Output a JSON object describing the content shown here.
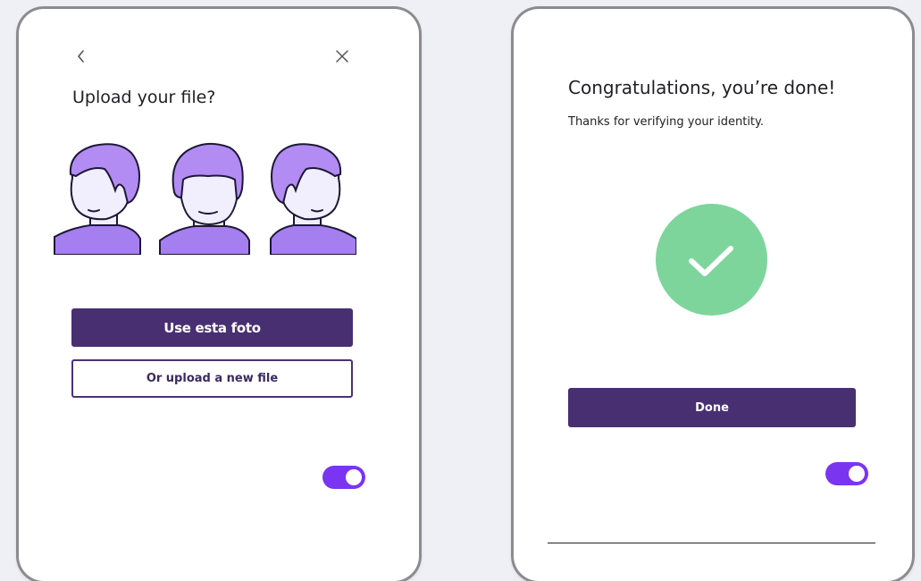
{
  "upload_screen": {
    "back_icon": "chevron-left-icon",
    "close_icon": "close-icon",
    "title": "Upload your file?",
    "illustration": [
      "face-left-profile",
      "face-front",
      "face-right-profile"
    ],
    "primary_button": "Use esta foto",
    "secondary_button": "Or upload a new file",
    "toggle_on": true
  },
  "done_screen": {
    "title": "Congratulations, you’re done!",
    "subtitle": "Thanks for verifying your identity.",
    "check_icon": "check-icon",
    "done_button": "Done",
    "toggle_on": true
  },
  "colors": {
    "primary": "#482f72",
    "toggle": "#7a35f1",
    "success": "#7dd59b",
    "hair": "#b28cf2",
    "skin": "#f1eefe",
    "shirt": "#a57ef0"
  }
}
